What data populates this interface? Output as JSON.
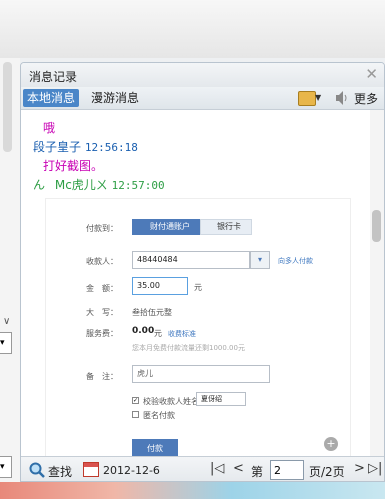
{
  "window": {
    "title": "消息记录"
  },
  "tabs": [
    {
      "label": "本地消息"
    },
    {
      "label": "漫游消息"
    }
  ],
  "toolbar": {
    "more_label": "更多"
  },
  "messages": [
    {
      "text": "哦"
    },
    {
      "sender": "段子皇子",
      "time": "12:56:18"
    },
    {
      "text": "打好截图。"
    },
    {
      "sender_prefix": "ん",
      "sender": "Mc虎儿ㄨ",
      "time": "12:57:00"
    }
  ],
  "screenshot": {
    "pay_to_label": "付款到：",
    "tab_account": "财付通账户",
    "tab_card": "银行卡",
    "receiver_label": "收款人：",
    "receiver_value": "48440484",
    "multi_link": "向多人付款",
    "amount_label": "金　额：",
    "amount_value": "35.00",
    "amount_unit": "元",
    "uppercase_label": "大　写：",
    "uppercase_value": "叁拾伍元整",
    "fee_label": "服务费：",
    "fee_value": "0.00",
    "fee_unit": "元",
    "fee_link": "收费标准",
    "fee_note": "您本月免费付款流量还剩1000.00元",
    "remark_label": "备　注：",
    "remark_value": "虎儿",
    "verify_label": "校验收款人姓名",
    "verify_value": "夏伢绍",
    "anon_label": "匿名付款",
    "pay_button": "付款"
  },
  "bottom": {
    "find_label": "查找",
    "date": "2012-12-6",
    "page_prefix": "第",
    "page_value": "2",
    "page_suffix": "页/2页"
  },
  "colors": {
    "message_text": "#c800b4",
    "sender_self": "#1a5fb0",
    "sender_other": "#2e9e45",
    "tab_active_bg": "#4a86c8"
  },
  "icons": {
    "close": "close-icon",
    "export": "export-icon",
    "sound": "speaker-icon",
    "find": "magnifier-icon",
    "calendar": "calendar-icon",
    "zoom": "zoom-in-icon"
  }
}
